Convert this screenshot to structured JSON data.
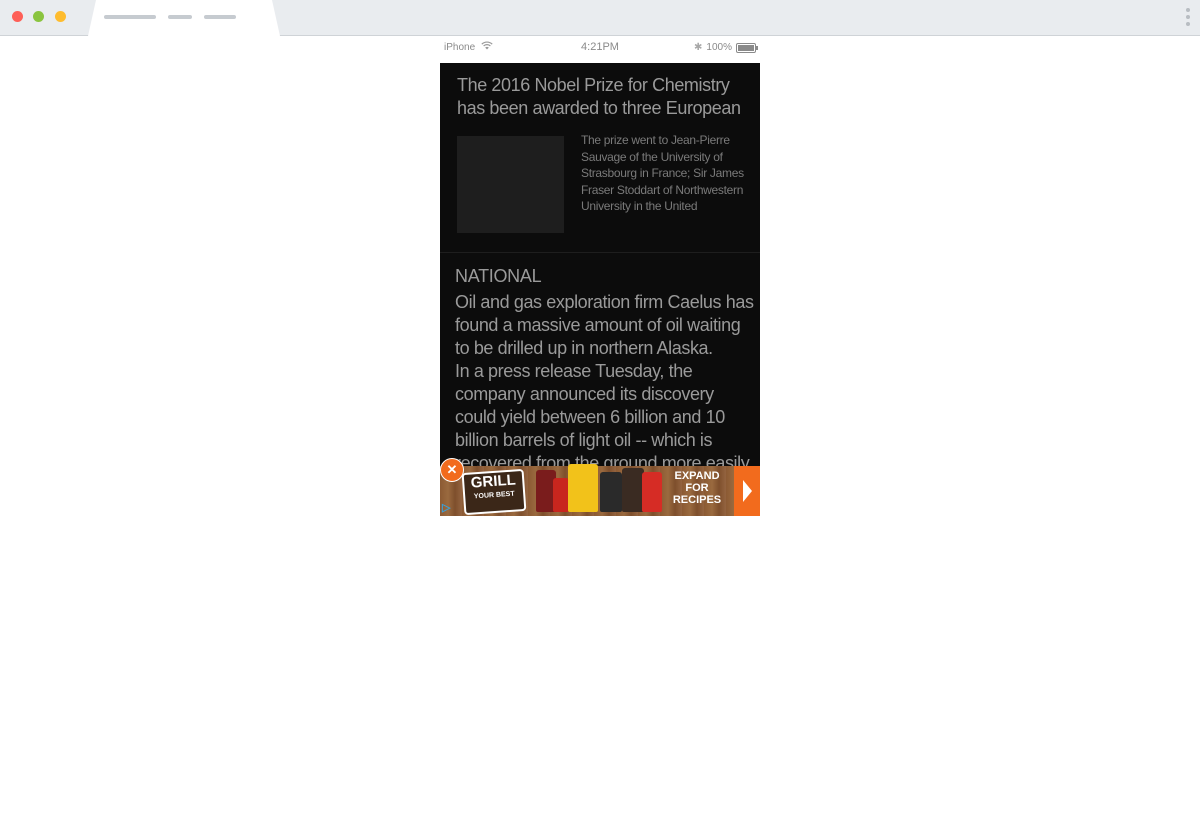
{
  "status_bar": {
    "carrier": "iPhone",
    "time": "4:21PM",
    "battery": "100%"
  },
  "story1": {
    "headline": "The 2016 Nobel Prize for Chemistry has been awarded to three European",
    "summary": "The prize went to Jean-Pierre Sauvage of the University of Strasbourg in France; Sir James Fraser Stoddart of Northwestern University in the United"
  },
  "story2": {
    "section": "NATIONAL",
    "paragraph1": "Oil and gas exploration firm Caelus has found a massive amount of oil waiting to be drilled up in northern Alaska.",
    "paragraph2": "In a press release Tuesday, the company announced its discovery could yield between 6 billion and 10 billion barrels of light oil -- which is recovered from the ground more easily than other types of"
  },
  "ad": {
    "badge_line1": "GRILL",
    "badge_line2": "YOUR BEST",
    "cta": "EXPAND FOR RECIPES",
    "colors": {
      "accent": "#f26b1d",
      "info": "#3aa0d8"
    }
  }
}
